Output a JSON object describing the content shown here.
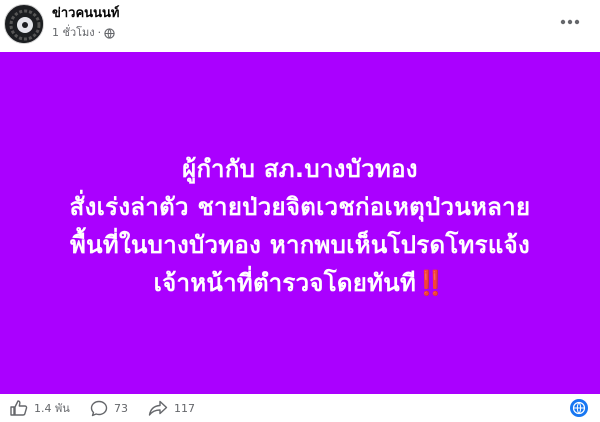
{
  "post": {
    "page_name": "ข่าวคนนนท์",
    "time": "1 ชั่วโมง",
    "separator": "·",
    "more_label": "···"
  },
  "content": {
    "background_color": "#aa00ff",
    "lines": [
      "ผู้กำกับ สภ.บางบัวทอง",
      "สั่งเร่งล่าตัว ชายป่วยจิตเวชก่อเหตุป่วนหลาย",
      "พื้นที่ในบางบัวทอง หากพบเห็นโปรดโทรแจ้ง",
      "เจ้าหน้าที่ตำรวจโดยทันที"
    ],
    "emphasis": "‼️"
  },
  "footer": {
    "likes": "1.4 พัน",
    "comments": "73",
    "shares": "117",
    "icons": [
      "like-icon",
      "comment-icon",
      "share-icon",
      "globe-icon"
    ]
  }
}
